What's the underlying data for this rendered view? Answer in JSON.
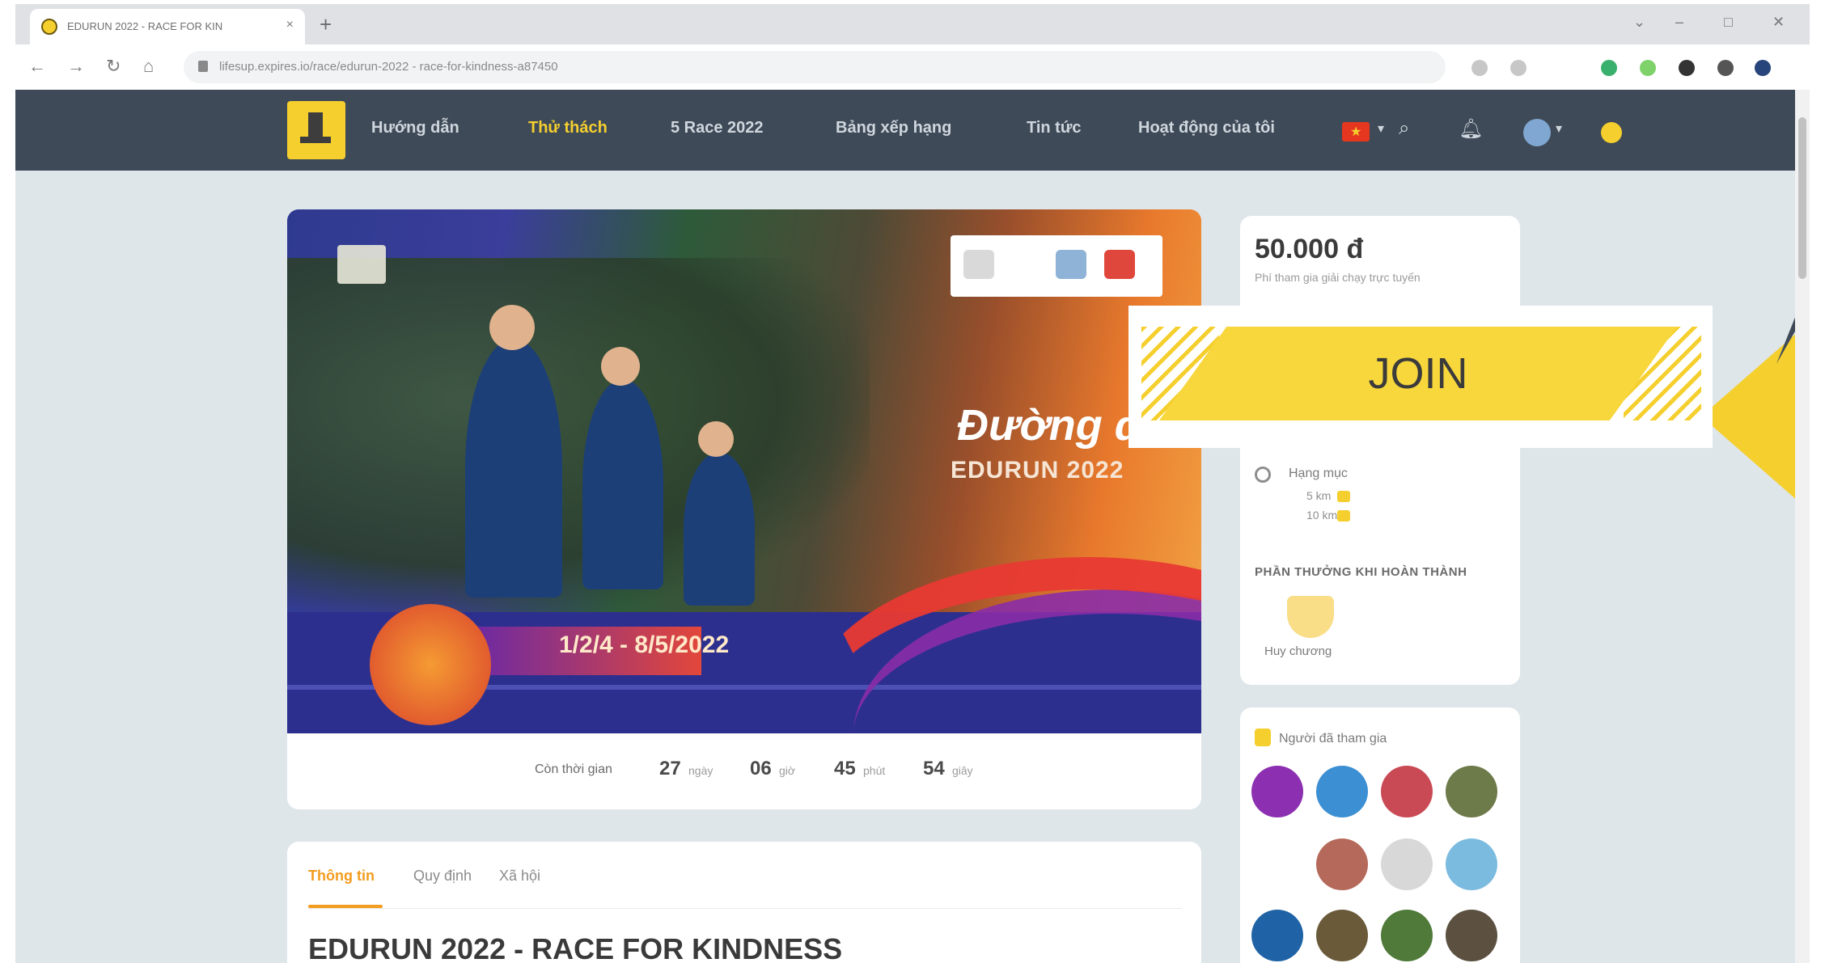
{
  "browser": {
    "tab_title": "EDURUN 2022 - RACE FOR KIN",
    "tab_close": "×",
    "new_tab": "+",
    "back": "←",
    "forward": "→",
    "reload": "↻",
    "url": "lifesup.expires.io/race/edurun-2022 - race-for-kindness-a87450"
  },
  "header": {
    "nav": [
      "Hướng dẫn",
      "Thử thách",
      "5 Race 2022",
      "Bảng xếp hạng",
      "Tin tức",
      "Hoạt động của tôi"
    ]
  },
  "hero": {
    "mark": "Đường đua",
    "mark2": "EDURUN 2022",
    "dates": "1/2/4 - 8/5/2022"
  },
  "countdown": {
    "label": "Còn thời gian",
    "items": [
      {
        "value": "27",
        "unit": "ngày"
      },
      {
        "value": "06",
        "unit": "giờ"
      },
      {
        "value": "45",
        "unit": "phút"
      },
      {
        "value": "54",
        "unit": "giây"
      }
    ]
  },
  "details": {
    "tabs": [
      "Thông tin",
      "Quy định",
      "Xã hội"
    ],
    "title": "EDURUN 2022 - RACE FOR KINDNESS"
  },
  "sidebar": {
    "price": "50.000 đ",
    "price_sub": "Phí tham gia giải chạy trực tuyến",
    "distance_label": "Hạng mục",
    "distances": [
      "5 km",
      "10 km"
    ],
    "rewards_head": "PHẦN THƯỞNG KHI HOÀN THÀNH",
    "medal_label": "Huy chương",
    "participants_title": "Người đã tham gia"
  },
  "overlay": {
    "join_label": "JOIN"
  },
  "colors": {
    "accent": "#f5cf2e",
    "header_bg": "#3f4a58",
    "active_tab": "#f39c1f"
  }
}
